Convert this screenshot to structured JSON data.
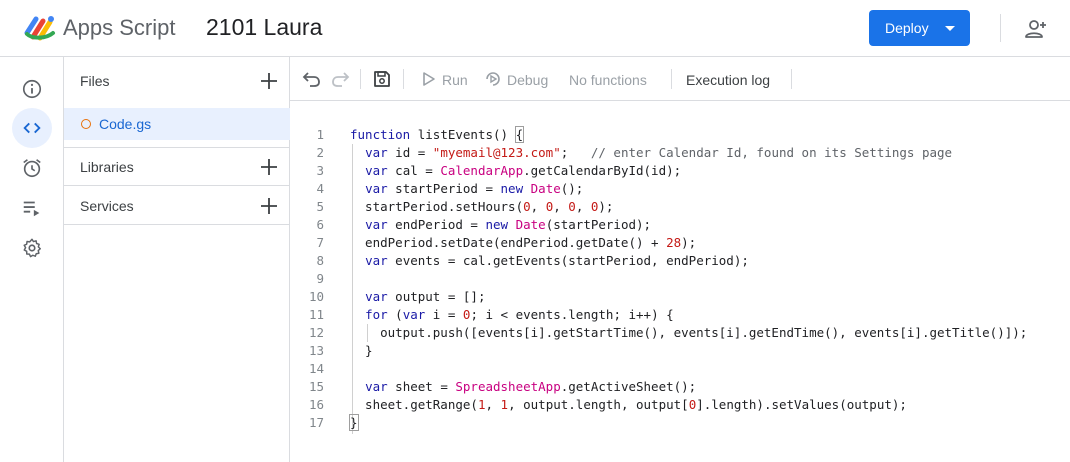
{
  "header": {
    "app_name": "Apps Script",
    "project_name": "2101 Laura",
    "deploy_label": "Deploy"
  },
  "rail": {
    "items": [
      {
        "icon": "info-icon"
      },
      {
        "icon": "code-icon",
        "active": true
      },
      {
        "icon": "alarm-icon"
      },
      {
        "icon": "executions-icon"
      },
      {
        "icon": "gear-icon"
      }
    ]
  },
  "files_panel": {
    "files_label": "Files",
    "file_name": "Code.gs",
    "libraries_label": "Libraries",
    "services_label": "Services"
  },
  "toolbar": {
    "run_label": "Run",
    "debug_label": "Debug",
    "function_select": "No functions",
    "execution_log_label": "Execution log"
  },
  "editor": {
    "line_numbers": [
      "1",
      "2",
      "3",
      "4",
      "5",
      "6",
      "7",
      "8",
      "9",
      "10",
      "11",
      "12",
      "13",
      "14",
      "15",
      "16",
      "17"
    ],
    "lines": [
      [
        {
          "t": "kw",
          "v": "function"
        },
        {
          "t": "",
          "v": " listEvents() "
        },
        {
          "t": "brace",
          "v": "{"
        }
      ],
      [
        {
          "t": "",
          "v": "  "
        },
        {
          "t": "kw",
          "v": "var"
        },
        {
          "t": "",
          "v": " id = "
        },
        {
          "t": "str",
          "v": "\"myemail@123.com\""
        },
        {
          "t": "",
          "v": ";   "
        },
        {
          "t": "cmt",
          "v": "// enter Calendar Id, found on its Settings page"
        }
      ],
      [
        {
          "t": "",
          "v": "  "
        },
        {
          "t": "kw",
          "v": "var"
        },
        {
          "t": "",
          "v": " cal = "
        },
        {
          "t": "cls",
          "v": "CalendarApp"
        },
        {
          "t": "",
          "v": ".getCalendarById(id);"
        }
      ],
      [
        {
          "t": "",
          "v": "  "
        },
        {
          "t": "kw",
          "v": "var"
        },
        {
          "t": "",
          "v": " startPeriod = "
        },
        {
          "t": "kw",
          "v": "new"
        },
        {
          "t": "",
          "v": " "
        },
        {
          "t": "cls",
          "v": "Date"
        },
        {
          "t": "",
          "v": "();"
        }
      ],
      [
        {
          "t": "",
          "v": "  startPeriod.setHours("
        },
        {
          "t": "num",
          "v": "0"
        },
        {
          "t": "",
          "v": ", "
        },
        {
          "t": "num",
          "v": "0"
        },
        {
          "t": "",
          "v": ", "
        },
        {
          "t": "num",
          "v": "0"
        },
        {
          "t": "",
          "v": ", "
        },
        {
          "t": "num",
          "v": "0"
        },
        {
          "t": "",
          "v": ");"
        }
      ],
      [
        {
          "t": "",
          "v": "  "
        },
        {
          "t": "kw",
          "v": "var"
        },
        {
          "t": "",
          "v": " endPeriod = "
        },
        {
          "t": "kw",
          "v": "new"
        },
        {
          "t": "",
          "v": " "
        },
        {
          "t": "cls",
          "v": "Date"
        },
        {
          "t": "",
          "v": "(startPeriod);"
        }
      ],
      [
        {
          "t": "",
          "v": "  endPeriod.setDate(endPeriod.getDate() + "
        },
        {
          "t": "num",
          "v": "28"
        },
        {
          "t": "",
          "v": ");"
        }
      ],
      [
        {
          "t": "",
          "v": "  "
        },
        {
          "t": "kw",
          "v": "var"
        },
        {
          "t": "",
          "v": " events = cal.getEvents(startPeriod, endPeriod);"
        }
      ],
      [],
      [
        {
          "t": "",
          "v": "  "
        },
        {
          "t": "kw",
          "v": "var"
        },
        {
          "t": "",
          "v": " output = [];"
        }
      ],
      [
        {
          "t": "",
          "v": "  "
        },
        {
          "t": "kw",
          "v": "for"
        },
        {
          "t": "",
          "v": " ("
        },
        {
          "t": "kw",
          "v": "var"
        },
        {
          "t": "",
          "v": " i = "
        },
        {
          "t": "num",
          "v": "0"
        },
        {
          "t": "",
          "v": "; i < events.length; i++) {"
        }
      ],
      [
        {
          "t": "",
          "v": "    output.push([events[i].getStartTime(), events[i].getEndTime(), events[i].getTitle()]);"
        }
      ],
      [
        {
          "t": "",
          "v": "  }"
        }
      ],
      [],
      [
        {
          "t": "",
          "v": "  "
        },
        {
          "t": "kw",
          "v": "var"
        },
        {
          "t": "",
          "v": " sheet = "
        },
        {
          "t": "cls",
          "v": "SpreadsheetApp"
        },
        {
          "t": "",
          "v": ".getActiveSheet();"
        }
      ],
      [
        {
          "t": "",
          "v": "  sheet.getRange("
        },
        {
          "t": "num",
          "v": "1"
        },
        {
          "t": "",
          "v": ", "
        },
        {
          "t": "num",
          "v": "1"
        },
        {
          "t": "",
          "v": ", output.length, output["
        },
        {
          "t": "num",
          "v": "0"
        },
        {
          "t": "",
          "v": "].length).setValues(output);"
        }
      ],
      [
        {
          "t": "brace",
          "v": "}"
        }
      ]
    ]
  },
  "colors": {
    "accent": "#1a73e8",
    "active_bg": "#e8f0fe",
    "keyword": "#1a1aa6",
    "string": "#c41a16",
    "class": "#c80080"
  }
}
